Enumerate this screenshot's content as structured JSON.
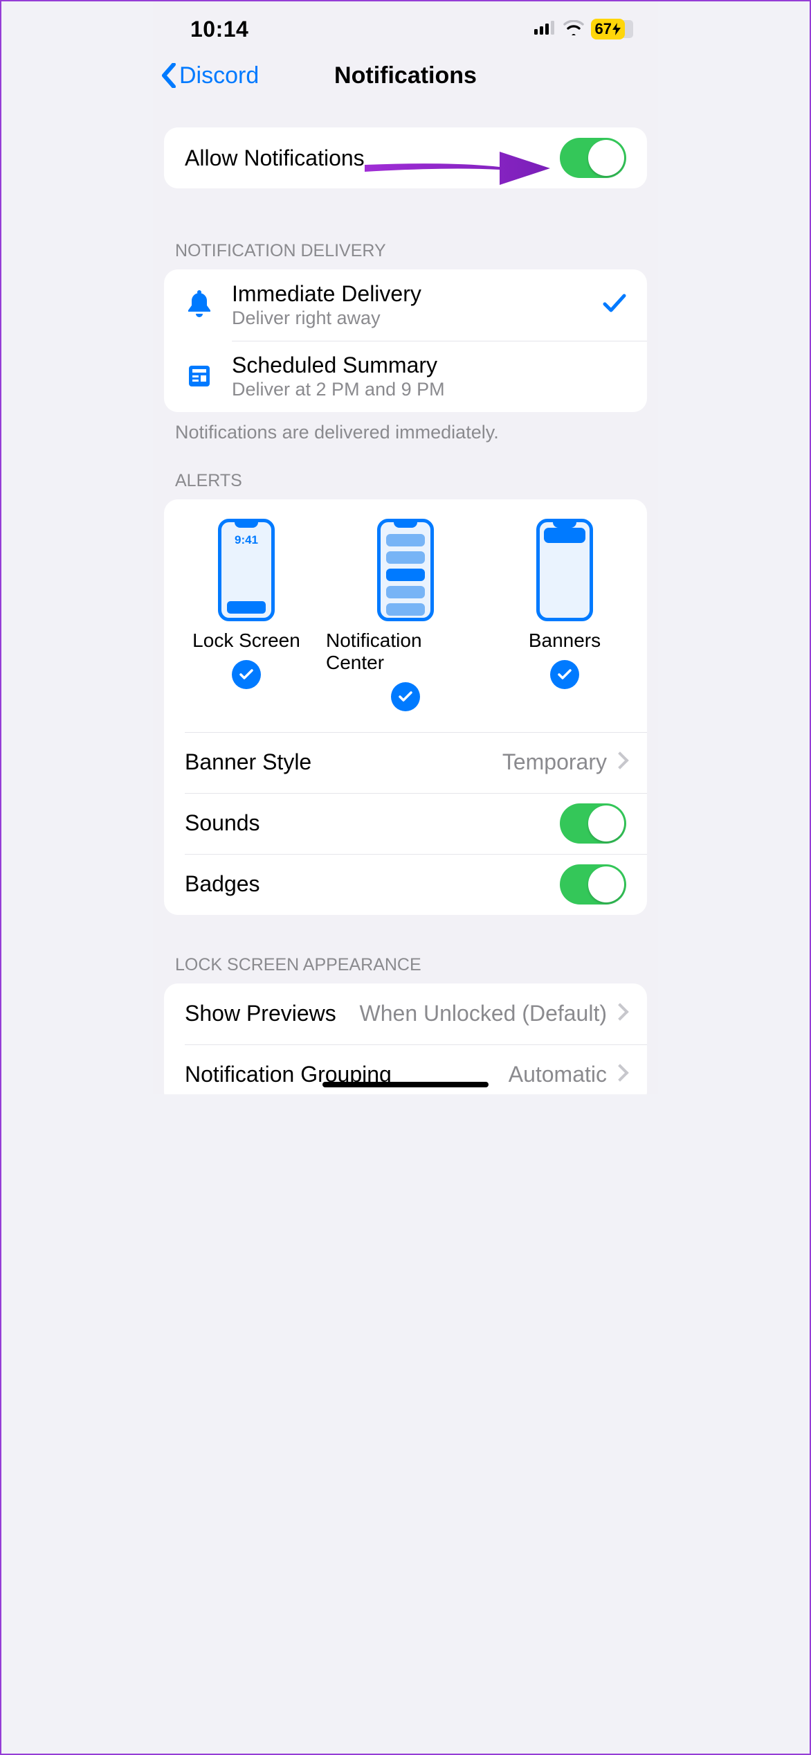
{
  "status": {
    "time": "10:14",
    "battery_percent": "67"
  },
  "nav": {
    "back_label": "Discord",
    "title": "Notifications"
  },
  "allow": {
    "label": "Allow Notifications",
    "enabled": true
  },
  "delivery": {
    "header": "Notification Delivery",
    "items": [
      {
        "title": "Immediate Delivery",
        "subtitle": "Deliver right away",
        "selected": true
      },
      {
        "title": "Scheduled Summary",
        "subtitle": "Deliver at 2 PM and 9 PM",
        "selected": false
      }
    ],
    "footer": "Notifications are delivered immediately."
  },
  "alerts": {
    "header": "Alerts",
    "preview_time": "9:41",
    "options": [
      {
        "label": "Lock Screen",
        "checked": true
      },
      {
        "label": "Notification Center",
        "checked": true
      },
      {
        "label": "Banners",
        "checked": true
      }
    ],
    "banner_style": {
      "label": "Banner Style",
      "value": "Temporary"
    },
    "sounds": {
      "label": "Sounds",
      "enabled": true
    },
    "badges": {
      "label": "Badges",
      "enabled": true
    }
  },
  "lock_screen": {
    "header": "Lock Screen Appearance",
    "show_previews": {
      "label": "Show Previews",
      "value": "When Unlocked (Default)"
    },
    "grouping": {
      "label": "Notification Grouping",
      "value": "Automatic"
    }
  }
}
